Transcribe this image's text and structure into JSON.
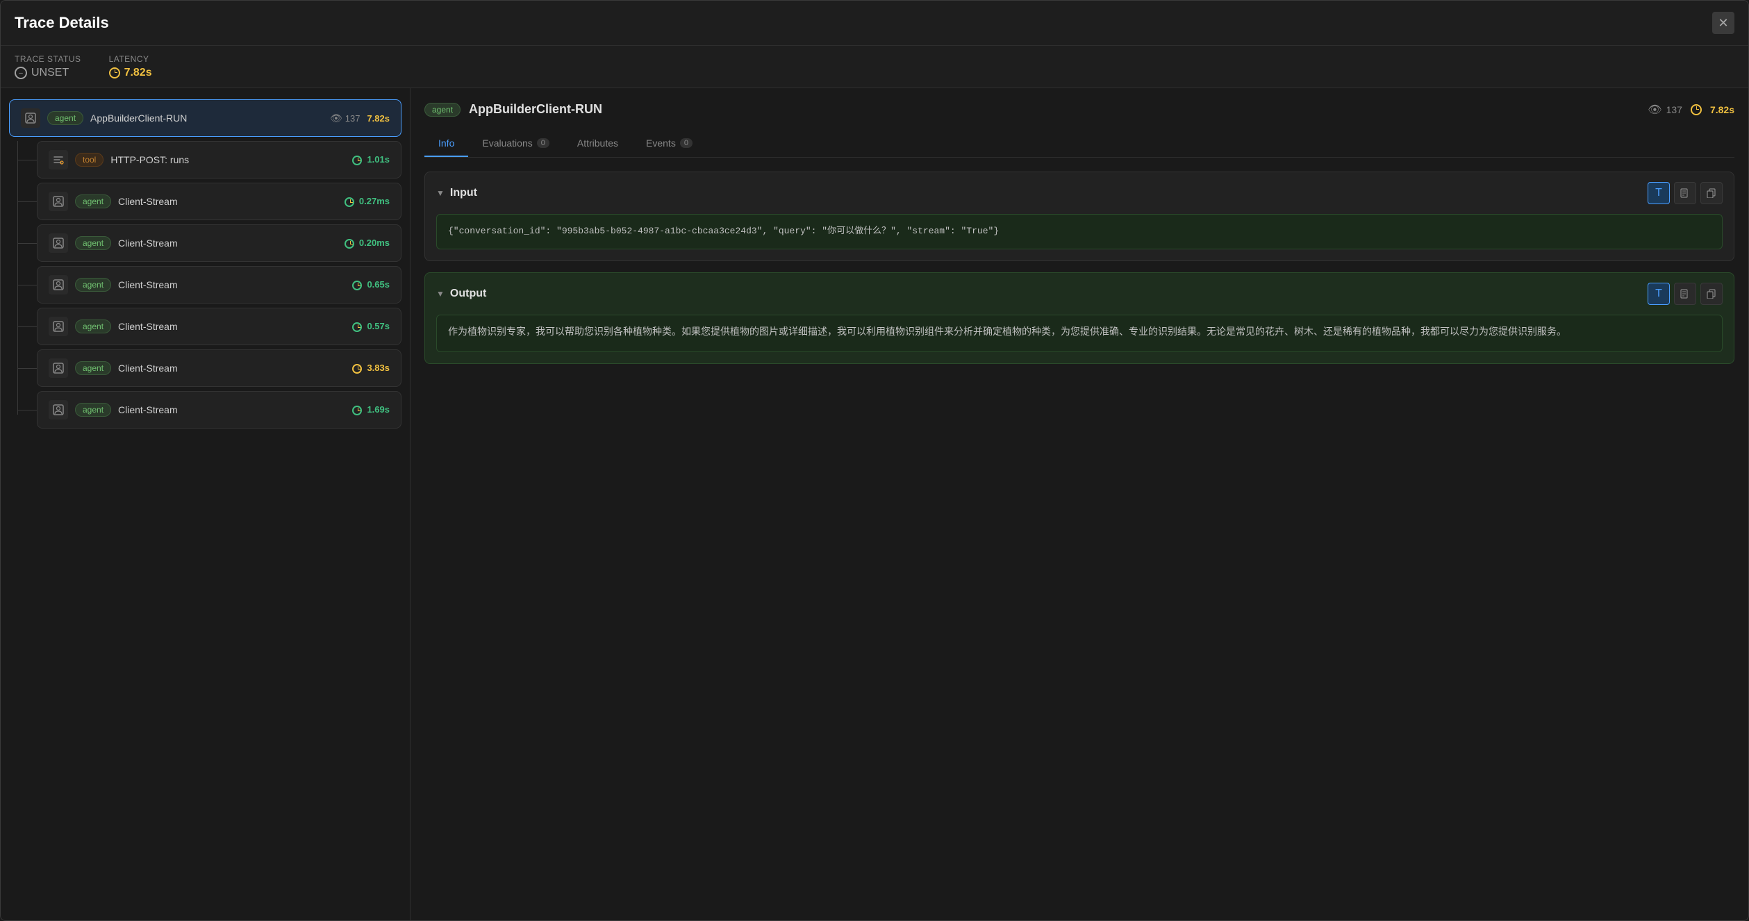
{
  "modal": {
    "title": "Trace Details",
    "close_label": "✕"
  },
  "status_bar": {
    "trace_status_label": "Trace Status",
    "trace_status_value": "UNSET",
    "latency_label": "Latency",
    "latency_value": "7.82s"
  },
  "left_panel": {
    "root_node": {
      "icon": "👤",
      "tag": "agent",
      "name": "AppBuilderClient-RUN",
      "count": "137",
      "latency": "7.82s",
      "latency_class": "latency-yellow"
    },
    "children": [
      {
        "icon": "🔧",
        "tag": "tool",
        "name": "HTTP-POST: runs",
        "latency": "1.01s",
        "latency_class": "latency-green"
      },
      {
        "icon": "👤",
        "tag": "agent",
        "name": "Client-Stream",
        "latency": "0.27ms",
        "latency_class": "latency-green"
      },
      {
        "icon": "👤",
        "tag": "agent",
        "name": "Client-Stream",
        "latency": "0.20ms",
        "latency_class": "latency-green"
      },
      {
        "icon": "👤",
        "tag": "agent",
        "name": "Client-Stream",
        "latency": "0.65s",
        "latency_class": "latency-green"
      },
      {
        "icon": "👤",
        "tag": "agent",
        "name": "Client-Stream",
        "latency": "0.57s",
        "latency_class": "latency-green"
      },
      {
        "icon": "👤",
        "tag": "agent",
        "name": "Client-Stream",
        "latency": "3.83s",
        "latency_class": "latency-yellow"
      },
      {
        "icon": "👤",
        "tag": "agent",
        "name": "Client-Stream",
        "latency": "1.69s",
        "latency_class": "latency-green"
      }
    ]
  },
  "right_panel": {
    "header": {
      "tag": "agent",
      "name": "AppBuilderClient-RUN",
      "count": "137",
      "latency": "7.82s"
    },
    "tabs": [
      {
        "label": "Info",
        "badge": null,
        "active": true
      },
      {
        "label": "Evaluations",
        "badge": "0",
        "active": false
      },
      {
        "label": "Attributes",
        "badge": null,
        "active": false
      },
      {
        "label": "Events",
        "badge": "0",
        "active": false
      }
    ],
    "input_section": {
      "title": "Input",
      "content": "{\"conversation_id\": \"995b3ab5-b052-4987-a1bc-cbcaa3ce24d3\", \"query\": \"你可以做什么？\", \"stream\": \"True\"}"
    },
    "output_section": {
      "title": "Output",
      "content": "作为植物识别专家，我可以帮助您识别各种植物种类。如果您提供植物的图片或详细描述，我可以利用植物识别组件来分析并确定植物的种类，为您提供准确、专业的识别结果。无论是常见的花卉、树木、还是稀有的植物品种，我都可以尽力为您提供识别服务。"
    },
    "buttons": {
      "text_label": "T",
      "doc_label": "📄",
      "copy_label": "📋"
    }
  }
}
